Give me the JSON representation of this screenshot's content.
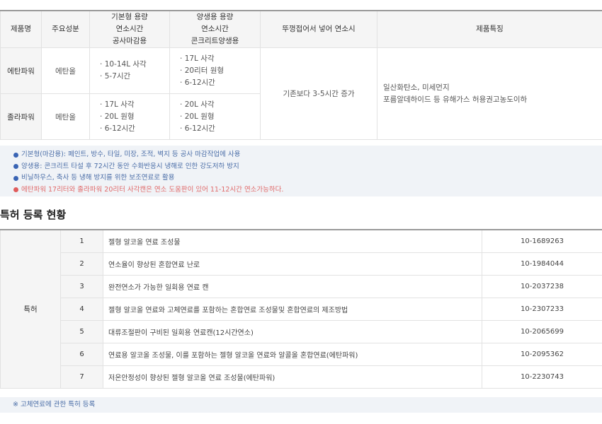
{
  "product_table": {
    "headers": {
      "name": "제품명",
      "ingredient": "주요성분",
      "basic": [
        "기본형 용량",
        "연소시간",
        "공사마감용"
      ],
      "curing": [
        "양생용 용량",
        "연소시간",
        "콘크리트양생용"
      ],
      "lid": "뚜껑접어서 넣어 연소시",
      "features": "제품특징"
    },
    "rows": [
      {
        "name": "에탄파워",
        "ingredient": "에탄올",
        "basic": [
          "10-14L 사각",
          "5-7시간"
        ],
        "curing": [
          "17L 사각",
          "20리터 원형",
          "6-12시간"
        ]
      },
      {
        "name": "졸라파워",
        "ingredient": "메탄올",
        "basic": [
          "17L 사각",
          "20L 원형",
          "6-12시간"
        ],
        "curing": [
          "20L 사각",
          "20L 원형",
          "6-12시간"
        ]
      }
    ],
    "lid_value": "기존보다 3-5시간 증가",
    "features": [
      "일산화탄소, 미세먼지",
      "포름알데하이드 등 유해가스 허용권고농도이하"
    ]
  },
  "notes": [
    {
      "text": "기본형(마감용): 페인트, 방수, 타일, 미장, 조적, 벽지 등 공사 마감작업에 사용",
      "color": "#3a64b4"
    },
    {
      "text": "양생용: 콘크리트 타설 후 72시간 동안 수화반응시 냉해로 인한 강도저하 방지",
      "color": "#3a64b4"
    },
    {
      "text": "비닐하우스, 축사 등 냉해 방지를 위한 보조연료로 활용",
      "color": "#3a64b4"
    },
    {
      "text": "에탄파워 17리터와 졸라파워 20리터 사각캔은 연소 도움판이 있어 11-12시간 연소가능하다.",
      "color": "#e05c5c"
    }
  ],
  "patent_section": {
    "title": "특허 등록 현황",
    "category": "특허",
    "items": [
      {
        "no": "1",
        "title": "젤형 알코올 연료 조성물",
        "reg": "10-1689263"
      },
      {
        "no": "2",
        "title": "연소율이 향상된 혼합연료 난로",
        "reg": "10-1984044"
      },
      {
        "no": "3",
        "title": "완전연소가 가능한 일회용 연료 캔",
        "reg": "10-2037238"
      },
      {
        "no": "4",
        "title": "젤형 알코올 연료와 고체연료를 포함하는 혼합연료 조성물및 혼합연료의 제조방법",
        "reg": "10-2307233"
      },
      {
        "no": "5",
        "title": "대류조절판이 구비된 일회용 연료캔(12시간연소)",
        "reg": "10-2065699"
      },
      {
        "no": "6",
        "title": "연료용 알코올 조성물, 이를 포함하는 젤형 알코올 연료와 알콜올 혼합연료(에탄파워)",
        "reg": "10-2095362"
      },
      {
        "no": "7",
        "title": "저온안정성이 향상된 젤형 알코올 연료 조성물(에탄파워)",
        "reg": "10-2230743"
      }
    ],
    "footnote": "※ 고체연료에 관한 특허 등록"
  }
}
